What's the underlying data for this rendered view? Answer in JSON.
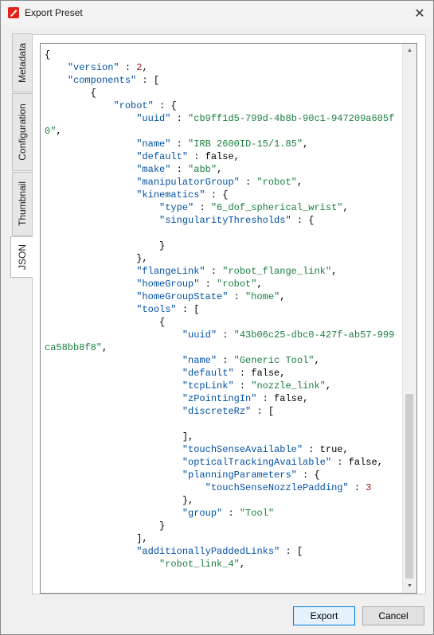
{
  "window": {
    "title": "Export Preset"
  },
  "icons": {
    "app": "app-logo-icon",
    "close": "close-icon",
    "scroll_up": "scroll-up-icon",
    "scroll_down": "scroll-down-icon"
  },
  "colors": {
    "key": "#0451a5",
    "string": "#1a7f3e",
    "number": "#a31515",
    "accent": "#0078d7",
    "app_icon": "#e2231a"
  },
  "tabs": [
    {
      "label": "Metadata",
      "active": false
    },
    {
      "label": "Configuration",
      "active": false
    },
    {
      "label": "Thumbnail",
      "active": false
    },
    {
      "label": "JSON",
      "active": true
    }
  ],
  "json_lines": [
    "{",
    "    \"version\" : 2,",
    "    \"components\" : [",
    "        {",
    "            \"robot\" : {",
    "                \"uuid\" : \"cb9ff1d5-799d-4b8b-90c1-947209a605f0\",",
    "                \"name\" : \"IRB 2600ID-15/1.85\",",
    "                \"default\" : false,",
    "                \"make\" : \"abb\",",
    "                \"manipulatorGroup\" : \"robot\",",
    "                \"kinematics\" : {",
    "                    \"type\" : \"6_dof_spherical_wrist\",",
    "                    \"singularityThresholds\" : {",
    "",
    "                    }",
    "                },",
    "                \"flangeLink\" : \"robot_flange_link\",",
    "                \"homeGroup\" : \"robot\",",
    "                \"homeGroupState\" : \"home\",",
    "                \"tools\" : [",
    "                    {",
    "                        \"uuid\" : \"43b06c25-dbc0-427f-ab57-999ca58bb8f8\",",
    "                        \"name\" : \"Generic Tool\",",
    "                        \"default\" : false,",
    "                        \"tcpLink\" : \"nozzle_link\",",
    "                        \"zPointingIn\" : false,",
    "                        \"discreteRz\" : [",
    "",
    "                        ],",
    "                        \"touchSenseAvailable\" : true,",
    "                        \"opticalTrackingAvailable\" : false,",
    "                        \"planningParameters\" : {",
    "                            \"touchSenseNozzlePadding\" : 3",
    "                        },",
    "                        \"group\" : \"Tool\"",
    "                    }",
    "                ],",
    "                \"additionallyPaddedLinks\" : [",
    "                    \"robot_link_4\","
  ],
  "buttons": {
    "export": "Export",
    "cancel": "Cancel"
  }
}
